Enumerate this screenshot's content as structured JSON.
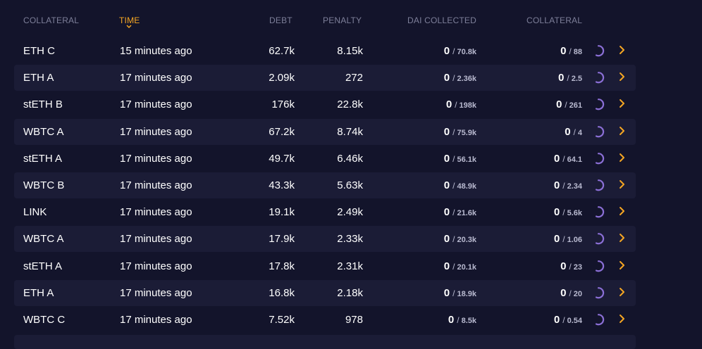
{
  "header": {
    "collateral": "COLLATERAL",
    "time": "TIME",
    "debt": "DEBT",
    "penalty": "PENALTY",
    "dai_collected": "DAI COLLECTED",
    "collateral2": "COLLATERAL"
  },
  "colors": {
    "accent": "#f5a623",
    "spinner": "#8b6fd6",
    "row_alt": "#1b1c36",
    "bg": "#13142b"
  },
  "icons": {
    "sort": "chevron-down-icon",
    "spinner": "loading-arc-icon",
    "row_action": "chevron-right-icon"
  },
  "rows": [
    {
      "collateral": "ETH C",
      "time": "15 minutes ago",
      "debt": "62.7k",
      "penalty": "8.15k",
      "dai": "0",
      "dai_total": "70.8k",
      "coll": "0",
      "coll_total": "88",
      "sep": "/"
    },
    {
      "collateral": "ETH A",
      "time": "17 minutes ago",
      "debt": "2.09k",
      "penalty": "272",
      "dai": "0",
      "dai_total": "2.36k",
      "coll": "0",
      "coll_total": "2.5",
      "sep": "/"
    },
    {
      "collateral": "stETH B",
      "time": "17 minutes ago",
      "debt": "176k",
      "penalty": "22.8k",
      "dai": "0",
      "dai_total": "198k",
      "coll": "0",
      "coll_total": "261",
      "sep": "/"
    },
    {
      "collateral": "WBTC A",
      "time": "17 minutes ago",
      "debt": "67.2k",
      "penalty": "8.74k",
      "dai": "0",
      "dai_total": "75.9k",
      "coll": "0",
      "coll_total": "4",
      "sep": "/"
    },
    {
      "collateral": "stETH A",
      "time": "17 minutes ago",
      "debt": "49.7k",
      "penalty": "6.46k",
      "dai": "0",
      "dai_total": "56.1k",
      "coll": "0",
      "coll_total": "64.1",
      "sep": "/"
    },
    {
      "collateral": "WBTC B",
      "time": "17 minutes ago",
      "debt": "43.3k",
      "penalty": "5.63k",
      "dai": "0",
      "dai_total": "48.9k",
      "coll": "0",
      "coll_total": "2.34",
      "sep": "/"
    },
    {
      "collateral": "LINK",
      "time": "17 minutes ago",
      "debt": "19.1k",
      "penalty": "2.49k",
      "dai": "0",
      "dai_total": "21.6k",
      "coll": "0",
      "coll_total": "5.6k",
      "sep": "/"
    },
    {
      "collateral": "WBTC A",
      "time": "17 minutes ago",
      "debt": "17.9k",
      "penalty": "2.33k",
      "dai": "0",
      "dai_total": "20.3k",
      "coll": "0",
      "coll_total": "1.06",
      "sep": "/"
    },
    {
      "collateral": "stETH A",
      "time": "17 minutes ago",
      "debt": "17.8k",
      "penalty": "2.31k",
      "dai": "0",
      "dai_total": "20.1k",
      "coll": "0",
      "coll_total": "23",
      "sep": "/"
    },
    {
      "collateral": "ETH A",
      "time": "17 minutes ago",
      "debt": "16.8k",
      "penalty": "2.18k",
      "dai": "0",
      "dai_total": "18.9k",
      "coll": "0",
      "coll_total": "20",
      "sep": "/"
    },
    {
      "collateral": "WBTC C",
      "time": "17 minutes ago",
      "debt": "7.52k",
      "penalty": "978",
      "dai": "0",
      "dai_total": "8.5k",
      "coll": "0",
      "coll_total": "0.54",
      "sep": "/"
    }
  ]
}
